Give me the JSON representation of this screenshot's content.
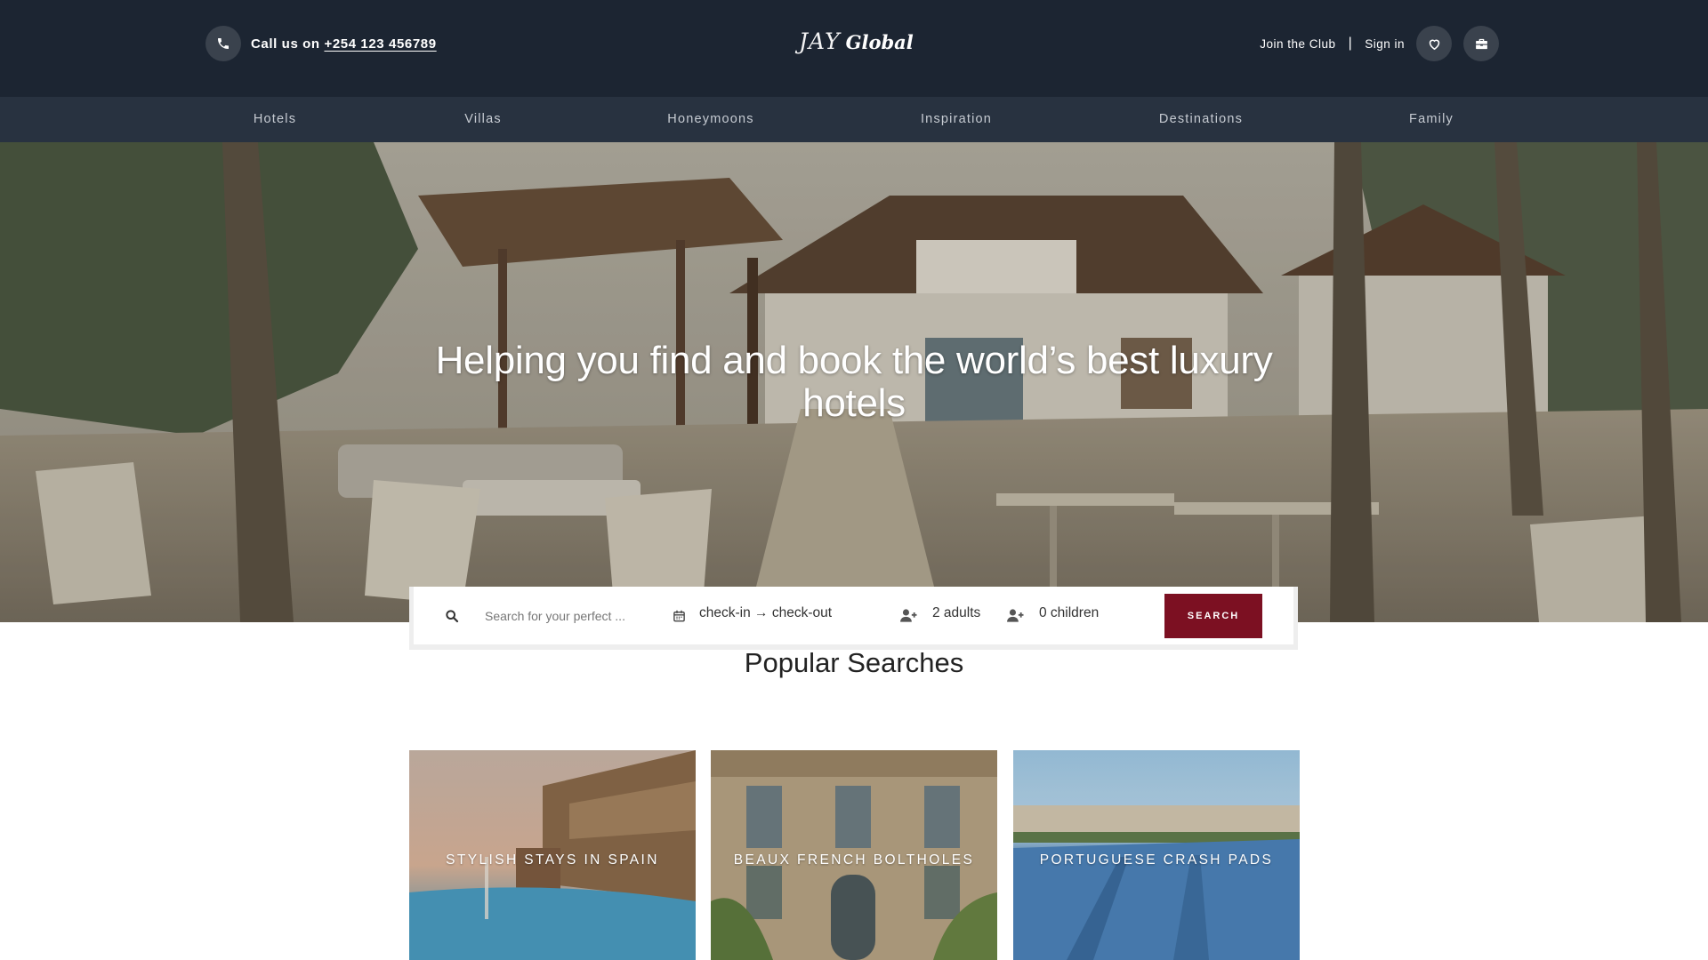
{
  "header": {
    "call_prefix": "Call us on",
    "phone": "+254 123 456789",
    "logo_script": "JAY",
    "logo_bold": "Global",
    "join_club": "Join the Club",
    "divider": "|",
    "sign_in": "Sign in",
    "icons": [
      "phone-icon",
      "heart-icon",
      "briefcase-icon"
    ]
  },
  "nav": {
    "items": [
      {
        "label": "Hotels"
      },
      {
        "label": "Villas"
      },
      {
        "label": "Honeymoons"
      },
      {
        "label": "Inspiration"
      },
      {
        "label": "Destinations"
      },
      {
        "label": "Family"
      }
    ]
  },
  "hero": {
    "title": "Helping you find and book the world’s best luxury hotels"
  },
  "search": {
    "placeholder": "Search for your perfect ...",
    "dates": "check-in → check-out",
    "adults": "2 adults",
    "children": "0 children",
    "button": "SEARCH"
  },
  "popular": {
    "title": "Popular Searches",
    "cards": [
      {
        "label": "STYLISH STAYS IN SPAIN"
      },
      {
        "label": "BEAUX FRENCH BOLTHOLES"
      },
      {
        "label": "PORTUGUESE CRASH PADS"
      }
    ]
  },
  "colors": {
    "header_bg": "#1c2532",
    "nav_bg": "#283240",
    "search_button": "#7c1022"
  }
}
